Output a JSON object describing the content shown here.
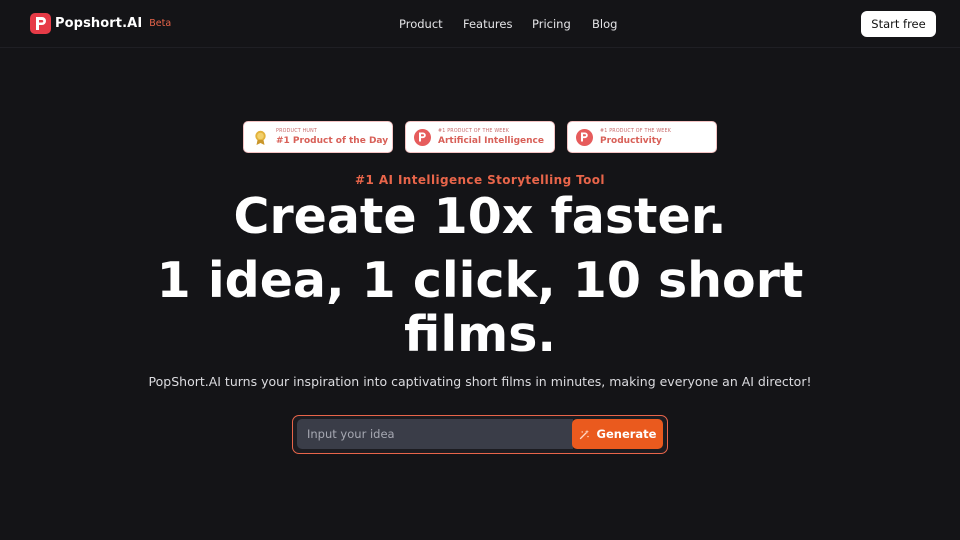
{
  "header": {
    "logo_text": "Popshort.AI",
    "beta_label": "Beta",
    "nav": {
      "product": "Product",
      "features": "Features",
      "pricing": "Pricing",
      "blog": "Blog"
    },
    "start_button": "Start free"
  },
  "badges": [
    {
      "small": "PRODUCT HUNT",
      "main": "#1 Product of the Day",
      "icon": "medal-icon"
    },
    {
      "small": "#1 PRODUCT OF THE WEEK",
      "main": "Artificial Intelligence",
      "icon": "product-hunt-icon"
    },
    {
      "small": "#1 PRODUCT OF THE WEEK",
      "main": "Productivity",
      "icon": "product-hunt-icon"
    }
  ],
  "hero": {
    "tagline": "#1 AI Intelligence Storytelling Tool",
    "headline_line1": "Create 10x faster.",
    "headline_line2": "1 idea, 1 click, 10 short",
    "headline_line3": "films.",
    "subtitle": "PopShort.AI turns your inspiration into captivating short films in minutes, making everyone an AI director!"
  },
  "idea_form": {
    "placeholder": "Input your idea",
    "value": "",
    "generate_label": "Generate"
  },
  "colors": {
    "background": "#141417",
    "accent": "#e8654a",
    "generate": "#ea5a1e",
    "brand": "#e63b47"
  }
}
